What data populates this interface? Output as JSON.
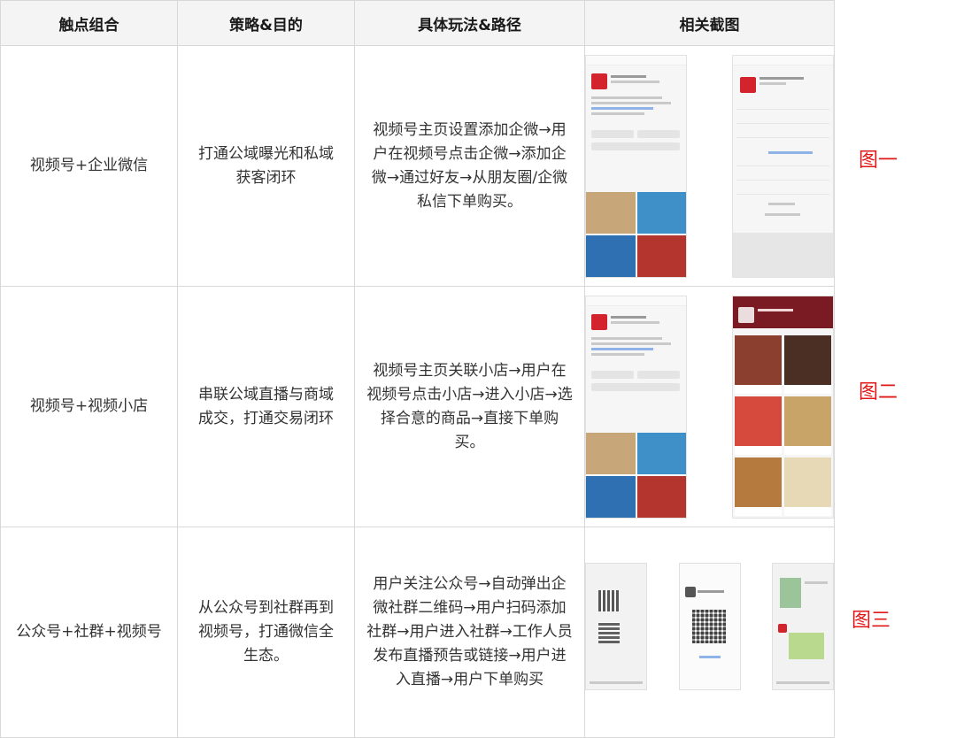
{
  "headers": [
    "触点组合",
    "策略&目的",
    "具体玩法&路径",
    "相关截图"
  ],
  "rows": [
    {
      "touchpoint": "视频号+企业微信",
      "strategy": "打通公域曝光和私域获客闭环",
      "path": "视频号主页设置添加企微→用户在视频号点击企微→添加企微→通过好友→从朋友圈/企微私信下单购买。",
      "figure": "图一"
    },
    {
      "touchpoint": "视频号+视频小店",
      "strategy": "串联公域直播与商域成交，打通交易闭环",
      "path": "视频号主页关联小店→用户在视频号点击小店→进入小店→选择合意的商品→直接下单购买。",
      "figure": "图二"
    },
    {
      "touchpoint": "公众号+社群+视频号",
      "strategy": "从公众号到社群再到视频号，打通微信全生态。",
      "path": "用户关注公众号→自动弹出企微社群二维码→用户扫码添加社群→用户进入社群→工作人员发布直播预告或链接→用户进入直播→用户下单购买",
      "figure": "图三"
    }
  ]
}
